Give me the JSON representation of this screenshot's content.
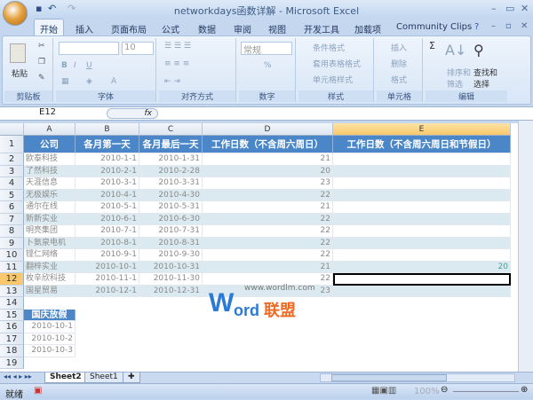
{
  "window": {
    "title": "networkdays函数详解 - Microsoft Excel"
  },
  "tabs": [
    "开始",
    "插入",
    "页面布局",
    "公式",
    "数据",
    "审阅",
    "视图",
    "开发工具",
    "加载项",
    "Community Clips"
  ],
  "ribbon": {
    "clipboard": {
      "label": "剪贴板",
      "paste": "粘贴"
    },
    "font": {
      "label": "字体",
      "size": "10",
      "bold": "B",
      "italic": "I",
      "underline": "U"
    },
    "alignment": {
      "label": "对齐方式"
    },
    "number": {
      "label": "数字",
      "format": "常规",
      "percent": "%"
    },
    "styles": {
      "label": "样式",
      "items": [
        "条件格式",
        "套用表格格式",
        "单元格样式"
      ]
    },
    "cells": {
      "label": "单元格",
      "items": [
        "插入",
        "删除",
        "格式"
      ]
    },
    "editing": {
      "label": "编辑",
      "sort": "排序和筛选",
      "find": "查找和选择"
    }
  },
  "formula_bar": {
    "name_box": "E12",
    "fx": "fx",
    "value": ""
  },
  "columns": [
    "A",
    "B",
    "C",
    "D",
    "E"
  ],
  "headers": [
    "公司",
    "各月第一天",
    "各月最后一天",
    "工作日数（不含周六周日）",
    "工作日数（不含周六周日和节假日）"
  ],
  "rows": [
    [
      "欧泰科技",
      "2010-1-1",
      "2010-1-31",
      "21",
      ""
    ],
    [
      "了然科技",
      "2010-2-1",
      "2010-2-28",
      "20",
      ""
    ],
    [
      "天涯信息",
      "2010-3-1",
      "2010-3-31",
      "23",
      ""
    ],
    [
      "无极娱乐",
      "2010-4-1",
      "2010-4-30",
      "22",
      ""
    ],
    [
      "通尔在线",
      "2010-5-1",
      "2010-5-31",
      "21",
      ""
    ],
    [
      "新新实业",
      "2010-6-1",
      "2010-6-30",
      "22",
      ""
    ],
    [
      "明亮集团",
      "2010-7-1",
      "2010-7-31",
      "22",
      ""
    ],
    [
      "卜氨泉电机",
      "2010-8-1",
      "2010-8-31",
      "22",
      ""
    ],
    [
      "铿仁网络",
      "2010-9-1",
      "2010-9-30",
      "22",
      ""
    ],
    [
      "翻梓实业",
      "2010-10-1",
      "2010-10-31",
      "21",
      "20"
    ],
    [
      "枚辛欣科技",
      "2010-11-1",
      "2010-11-30",
      "22",
      ""
    ],
    [
      "国星贸易",
      "2010-12-1",
      "2010-12-31",
      "23",
      ""
    ]
  ],
  "holidays": {
    "header": "国庆放假",
    "dates": [
      "2010-10-1",
      "2010-10-2",
      "2010-10-3"
    ]
  },
  "row_numbers": [
    "1",
    "2",
    "3",
    "4",
    "5",
    "6",
    "7",
    "8",
    "9",
    "10",
    "11",
    "12",
    "13",
    "14",
    "15",
    "16",
    "17",
    "18",
    "19"
  ],
  "sheets": [
    "Sheet2",
    "Sheet1"
  ],
  "status": {
    "text": "就绪",
    "zoom": "100%"
  },
  "watermark": {
    "url": "www.wordlm.com",
    "logo": "Word联盟"
  }
}
